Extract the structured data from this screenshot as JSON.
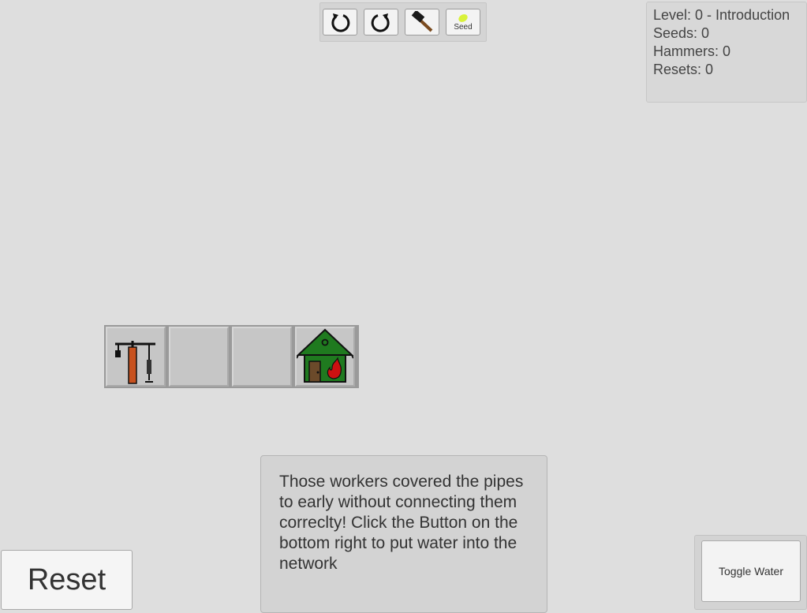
{
  "toolbar": {
    "rotate_left_icon": "rotate-left-icon",
    "rotate_right_icon": "rotate-right-icon",
    "hammer_icon": "hammer-icon",
    "seed_label": "Seed"
  },
  "status": {
    "level": "Level: 0 - Introduction",
    "seeds": "Seeds: 0",
    "hammers": "Hammers: 0",
    "resets": "Resets: 0"
  },
  "grid": {
    "tiles": [
      {
        "content": "water-source-icon"
      },
      {
        "content": "empty"
      },
      {
        "content": "empty"
      },
      {
        "content": "burning-house-icon"
      }
    ]
  },
  "message": {
    "text": "Those workers covered the pipes to early without connecting them correclty! Click the Button on the bottom right to put water into the network"
  },
  "buttons": {
    "reset_label": "Reset",
    "toggle_water_label": "Toggle Water"
  },
  "colors": {
    "background": "#dedede",
    "house_green": "#1f7a1f",
    "fire_red": "#cc1111",
    "pipe_orange": "#c8521f",
    "seed_yellow": "#d9f23a"
  }
}
